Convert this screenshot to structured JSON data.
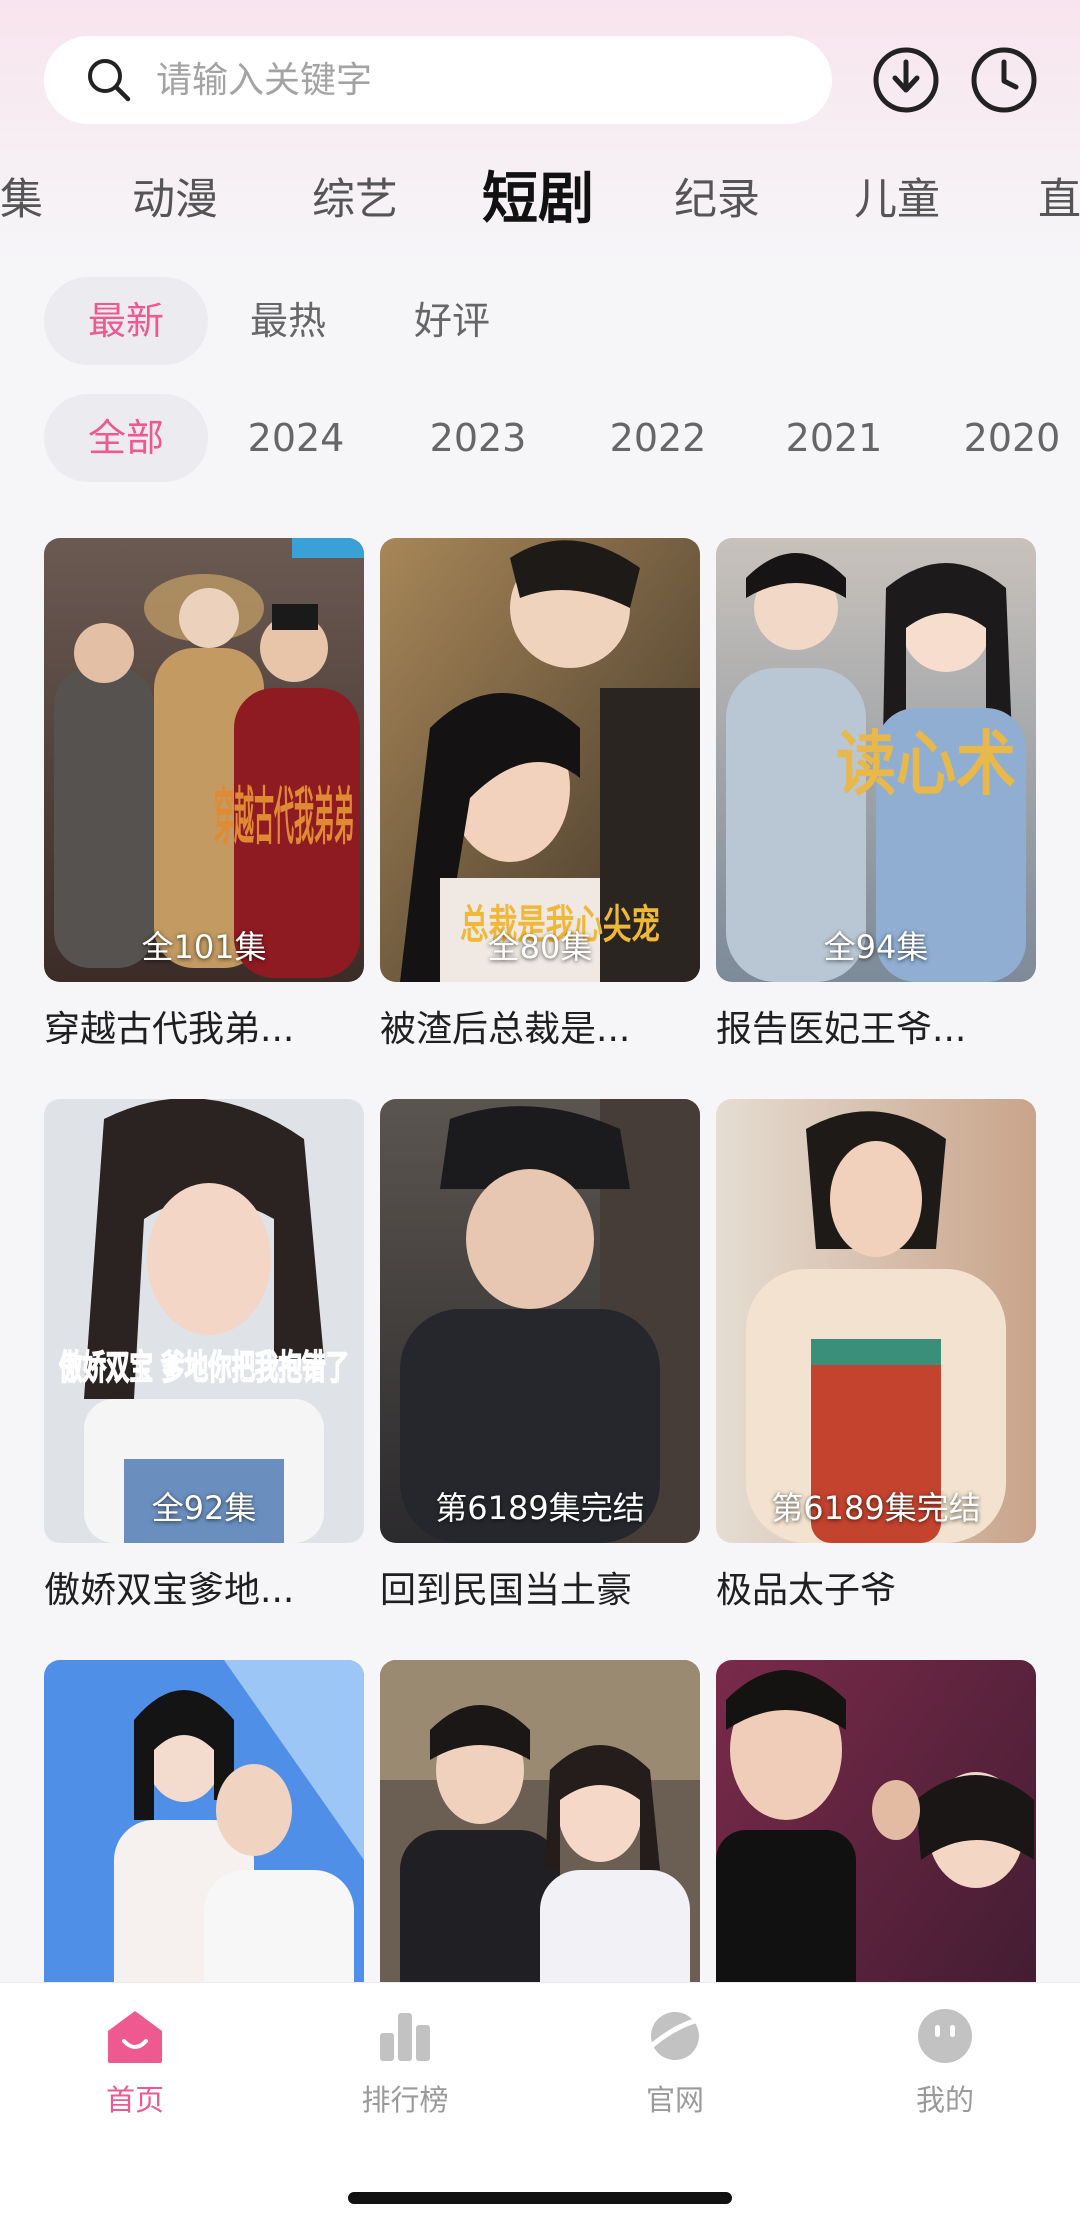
{
  "search": {
    "placeholder": "请输入关键字"
  },
  "categories": [
    {
      "label": "集"
    },
    {
      "label": "动漫"
    },
    {
      "label": "综艺"
    },
    {
      "label": "短剧",
      "active": true
    },
    {
      "label": "纪录"
    },
    {
      "label": "儿童"
    },
    {
      "label": "直"
    }
  ],
  "sort_filters": [
    {
      "label": "最新",
      "active": true
    },
    {
      "label": "最热"
    },
    {
      "label": "好评"
    }
  ],
  "year_filters": [
    {
      "label": "全部",
      "active": true
    },
    {
      "label": "2024"
    },
    {
      "label": "2023"
    },
    {
      "label": "2022"
    },
    {
      "label": "2021"
    },
    {
      "label": "2020"
    }
  ],
  "dramas": [
    {
      "title": "穿越古代我弟...",
      "badge": "全101集",
      "poster_text": "穿越古代我弟弟"
    },
    {
      "title": "被渣后总裁是...",
      "badge": "全80集",
      "poster_text": "总裁是我心尖宠"
    },
    {
      "title": "报告医妃王爷...",
      "badge": "全94集",
      "poster_text": "读心术"
    },
    {
      "title": "傲娇双宝爹地...",
      "badge": "全92集",
      "poster_text": "傲娇双宝 爹地你把我抱错了"
    },
    {
      "title": "回到民国当土豪",
      "badge": "第6189集完结"
    },
    {
      "title": "极品太子爷",
      "badge": "第6189集完结"
    },
    {
      "title": "",
      "badge": ""
    },
    {
      "title": "",
      "badge": ""
    },
    {
      "title": "",
      "badge": ""
    }
  ],
  "bottom_nav": [
    {
      "label": "首页",
      "icon": "home-icon",
      "active": true
    },
    {
      "label": "排行榜",
      "icon": "ranking-icon"
    },
    {
      "label": "官网",
      "icon": "planet-icon"
    },
    {
      "label": "我的",
      "icon": "profile-icon"
    }
  ],
  "colors": {
    "accent": "#ee5a8f",
    "inactive_nav": "#bdbdbd"
  }
}
